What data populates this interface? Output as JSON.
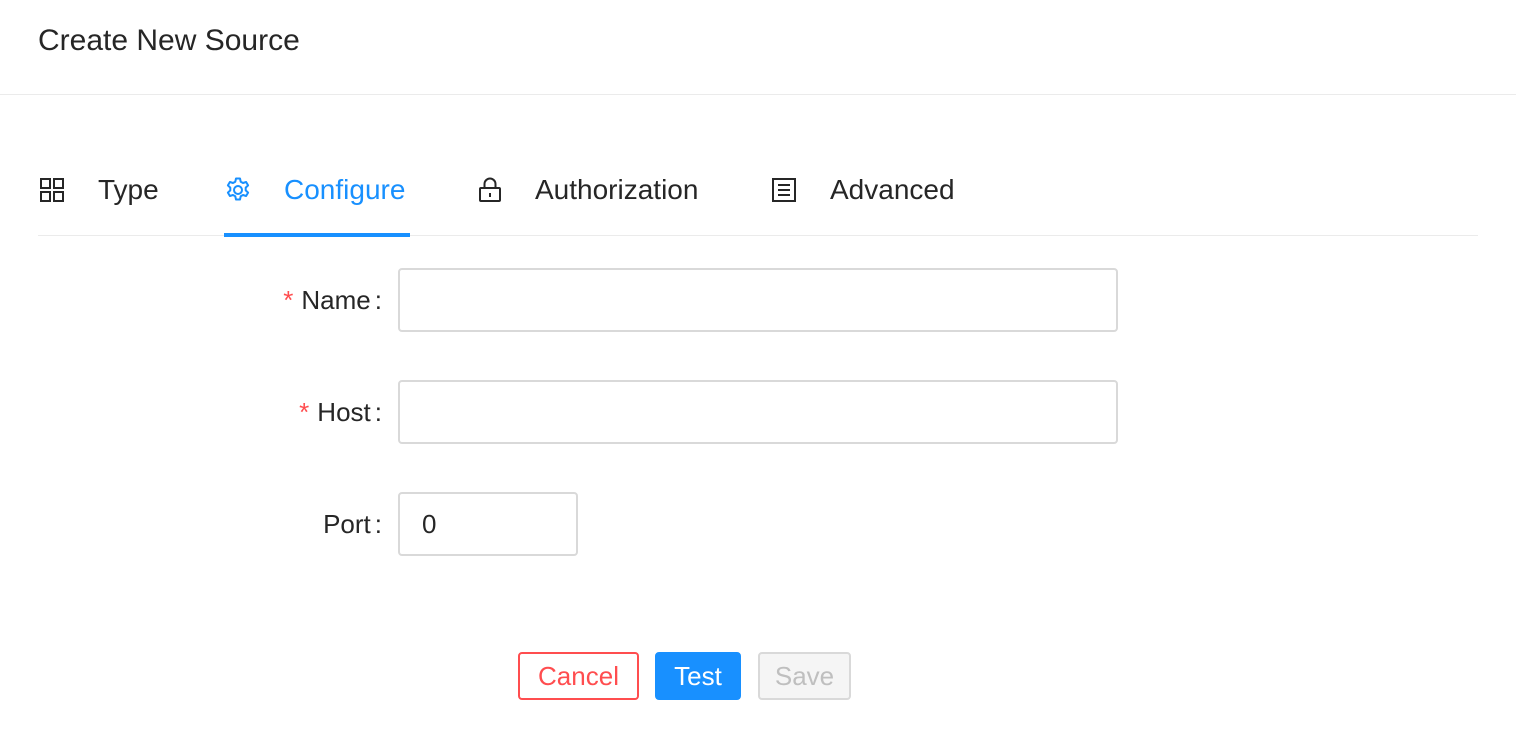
{
  "header": {
    "title": "Create New Source"
  },
  "tabs": [
    {
      "label": "Type",
      "icon": "appstore-icon",
      "active": false
    },
    {
      "label": "Configure",
      "icon": "gear-icon",
      "active": true
    },
    {
      "label": "Authorization",
      "icon": "lock-icon",
      "active": false
    },
    {
      "label": "Advanced",
      "icon": "border-outer-icon",
      "active": false
    }
  ],
  "form": {
    "name": {
      "label": "Name",
      "required": true,
      "value": ""
    },
    "host": {
      "label": "Host",
      "required": true,
      "value": ""
    },
    "port": {
      "label": "Port",
      "required": false,
      "value": "0"
    },
    "required_mark": "*",
    "colon": ":"
  },
  "actions": {
    "cancel_label": "Cancel",
    "test_label": "Test",
    "save_label": "Save"
  },
  "colors": {
    "primary": "#1890ff",
    "danger": "#ff4d4f",
    "disabled_text": "#bfbfbf",
    "border": "#d9d9d9"
  }
}
